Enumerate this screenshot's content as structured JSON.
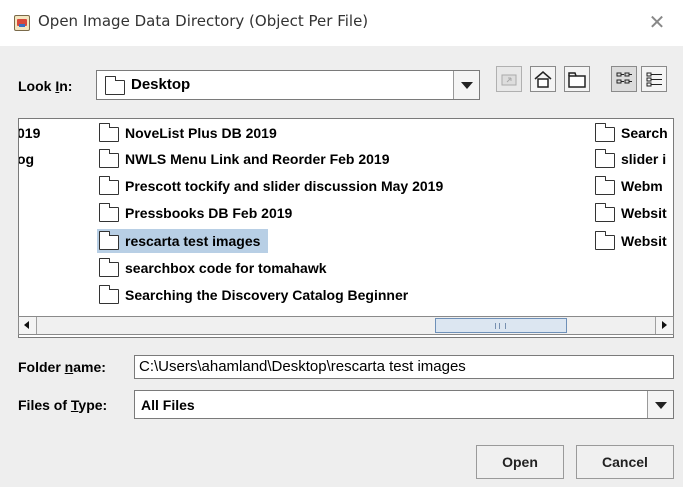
{
  "window": {
    "title": "Open Image Data Directory (Object Per File)",
    "close_glyph": "✕",
    "app_icon": "java-cup-icon"
  },
  "look_in": {
    "label_pre": "Look ",
    "label_mnemonic": "I",
    "label_post": "n:",
    "value": "Desktop"
  },
  "toolbar": {
    "buttons": [
      "up-one-level-icon",
      "home-icon",
      "new-folder-icon",
      "list-view-icon",
      "details-view-icon"
    ]
  },
  "files": {
    "col_left": [
      "019",
      "og"
    ],
    "col_main": [
      "NoveList Plus DB 2019",
      "NWLS Menu Link and Reorder Feb 2019",
      "Prescott tockify and slider discussion May 2019",
      "Pressbooks DB Feb 2019",
      "rescarta test images",
      "searchbox code for tomahawk",
      "Searching the Discovery Catalog Beginner"
    ],
    "selected": "rescarta test images",
    "col_right": [
      "Search",
      "slider i",
      "Webm",
      "Websit",
      "Websit"
    ]
  },
  "folder_name": {
    "label_pre": "Folder ",
    "label_mnemonic": "n",
    "label_post": "ame:",
    "value": "C:\\Users\\ahamland\\Desktop\\rescarta test images"
  },
  "files_of_type": {
    "label_pre": "Files of ",
    "label_mnemonic": "T",
    "label_post": "ype:",
    "value": "All Files"
  },
  "buttons": {
    "open": "Open",
    "cancel": "Cancel"
  },
  "colors": {
    "selection": "#b8cfe5",
    "dialog_bg": "#eeeeee"
  }
}
